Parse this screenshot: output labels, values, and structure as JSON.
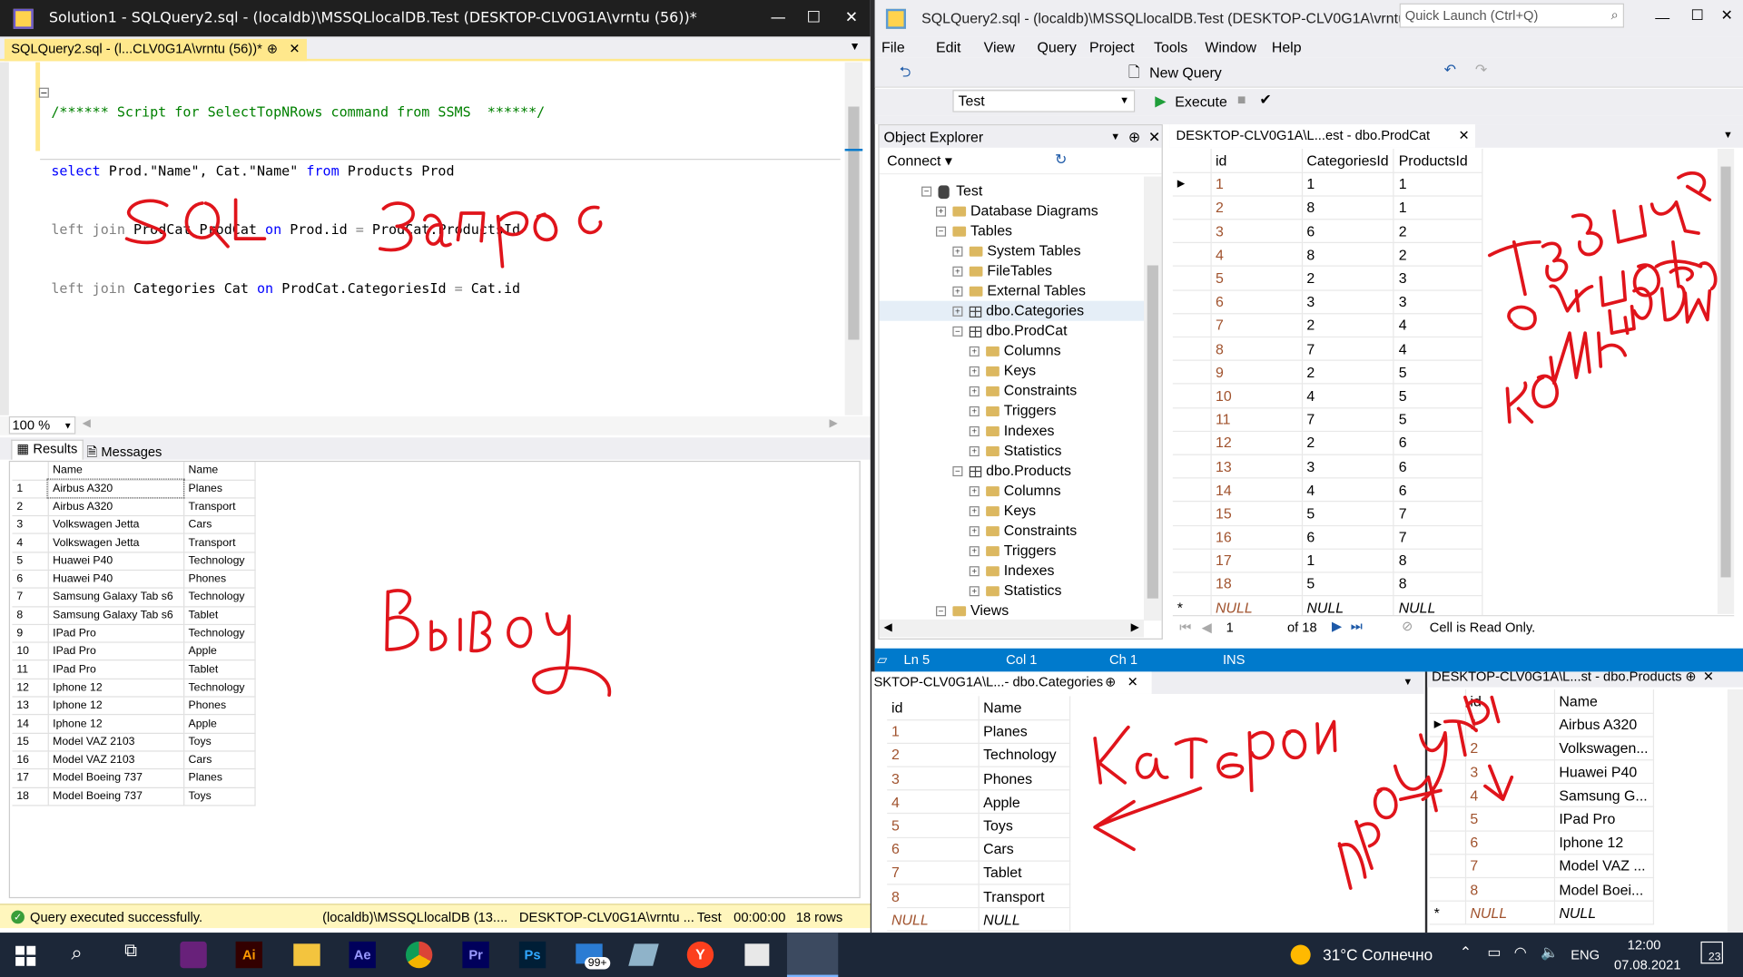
{
  "left_window": {
    "title": "Solution1 - SQLQuery2.sql - (localdb)\\MSSQLlocalDB.Test (DESKTOP-CLV0G1A\\vrntu (56))*",
    "tab": "SQLQuery2.sql - (l...CLV0G1A\\vrntu (56))*",
    "zoom": "100 %",
    "results_tab": "Results",
    "messages_tab": "Messages"
  },
  "sql": {
    "comment": "/****** Script for SelectTopNRows command from SSMS  ******/",
    "line2a": "select",
    "line2b": " Prod.\"Name\", Cat.\"Name\" ",
    "line2c": "from",
    "line2d": " Products Prod",
    "line3a": "left join",
    "line3b": " ProdCat ProdCat ",
    "line3c": "on",
    "line3d": " Prod.id ",
    "line3e": "=",
    "line3f": " ProdCat.ProductsId",
    "line4a": "left join",
    "line4b": " Categories Cat ",
    "line4c": "on",
    "line4d": " ProdCat.CategoriesId ",
    "line4e": "=",
    "line4f": " Cat.id"
  },
  "results": {
    "col1": "Name",
    "col2": "Name",
    "rows": [
      [
        "1",
        "Airbus A320",
        "Planes"
      ],
      [
        "2",
        "Airbus A320",
        "Transport"
      ],
      [
        "3",
        "Volkswagen Jetta",
        "Cars"
      ],
      [
        "4",
        "Volkswagen Jetta",
        "Transport"
      ],
      [
        "5",
        "Huawei P40",
        "Technology"
      ],
      [
        "6",
        "Huawei P40",
        "Phones"
      ],
      [
        "7",
        "Samsung Galaxy Tab s6",
        "Technology"
      ],
      [
        "8",
        "Samsung Galaxy Tab s6",
        "Tablet"
      ],
      [
        "9",
        "IPad Pro",
        "Technology"
      ],
      [
        "10",
        "IPad Pro",
        "Apple"
      ],
      [
        "11",
        "IPad Pro",
        "Tablet"
      ],
      [
        "12",
        "Iphone 12",
        "Technology"
      ],
      [
        "13",
        "Iphone 12",
        "Phones"
      ],
      [
        "14",
        "Iphone 12",
        "Apple"
      ],
      [
        "15",
        "Model VAZ 2103",
        "Toys"
      ],
      [
        "16",
        "Model VAZ 2103",
        "Cars"
      ],
      [
        "17",
        "Model Boeing 737",
        "Planes"
      ],
      [
        "18",
        "Model Boeing 737",
        "Toys"
      ]
    ]
  },
  "status_left": {
    "msg": "Query executed successfully.",
    "server": "(localdb)\\MSSQLlocalDB (13....",
    "user": "DESKTOP-CLV0G1A\\vrntu ...",
    "db": "Test",
    "time": "00:00:00",
    "rows": "18 rows"
  },
  "right_window": {
    "title": "SQLQuery2.sql - (localdb)\\MSSQLlocalDB.Test (DESKTOP-CLV0G1A\\vrntu (56))...",
    "quick_launch": "Quick Launch (Ctrl+Q)",
    "menu": [
      "File",
      "Edit",
      "View",
      "Query",
      "Project",
      "Tools",
      "Window",
      "Help"
    ],
    "new_query": "New Query",
    "db_select": "Test",
    "execute": "Execute"
  },
  "object_explorer": {
    "title": "Object Explorer",
    "connect": "Connect",
    "tree": [
      "Test",
      "Database Diagrams",
      "Tables",
      "System Tables",
      "FileTables",
      "External Tables",
      "dbo.Categories",
      "dbo.ProdCat",
      "Columns",
      "Keys",
      "Constraints",
      "Triggers",
      "Indexes",
      "Statistics",
      "dbo.Products",
      "Columns",
      "Keys",
      "Constraints",
      "Triggers",
      "Indexes",
      "Statistics",
      "Views"
    ]
  },
  "prodcat": {
    "tab": "DESKTOP-CLV0G1A\\L...est - dbo.ProdCat",
    "cols": [
      "id",
      "CategoriesId",
      "ProductsId"
    ],
    "rows": [
      [
        "1",
        "1",
        "1"
      ],
      [
        "2",
        "8",
        "1"
      ],
      [
        "3",
        "6",
        "2"
      ],
      [
        "4",
        "8",
        "2"
      ],
      [
        "5",
        "2",
        "3"
      ],
      [
        "6",
        "3",
        "3"
      ],
      [
        "7",
        "2",
        "4"
      ],
      [
        "8",
        "7",
        "4"
      ],
      [
        "9",
        "2",
        "5"
      ],
      [
        "10",
        "4",
        "5"
      ],
      [
        "11",
        "7",
        "5"
      ],
      [
        "12",
        "2",
        "6"
      ],
      [
        "13",
        "3",
        "6"
      ],
      [
        "14",
        "4",
        "6"
      ],
      [
        "15",
        "5",
        "7"
      ],
      [
        "16",
        "6",
        "7"
      ],
      [
        "17",
        "1",
        "8"
      ],
      [
        "18",
        "5",
        "8"
      ]
    ],
    "null": "NULL",
    "page": "1",
    "of": "of 18",
    "readonly": "Cell is Read Only."
  },
  "status_right": {
    "ln": "Ln 5",
    "col": "Col 1",
    "ch": "Ch 1",
    "ins": "INS"
  },
  "categories": {
    "tab": "SKTOP-CLV0G1A\\L...- dbo.Categories",
    "cols": [
      "id",
      "Name"
    ],
    "rows": [
      [
        "1",
        "Planes"
      ],
      [
        "2",
        "Technology"
      ],
      [
        "3",
        "Phones"
      ],
      [
        "4",
        "Apple"
      ],
      [
        "5",
        "Toys"
      ],
      [
        "6",
        "Cars"
      ],
      [
        "7",
        "Tablet"
      ],
      [
        "8",
        "Transport"
      ]
    ],
    "null": "NULL"
  },
  "products": {
    "tab": "DESKTOP-CLV0G1A\\L...st - dbo.Products",
    "cols": [
      "id",
      "Name"
    ],
    "rows": [
      [
        "1",
        "Airbus A320"
      ],
      [
        "2",
        "Volkswagen..."
      ],
      [
        "3",
        "Huawei P40"
      ],
      [
        "4",
        "Samsung G..."
      ],
      [
        "5",
        "IPad Pro"
      ],
      [
        "6",
        "Iphone 12"
      ],
      [
        "7",
        "Model VAZ ..."
      ],
      [
        "8",
        "Model Boei..."
      ]
    ],
    "null": "NULL"
  },
  "taskbar": {
    "weather": "31°C  Солнечно",
    "lang": "ENG",
    "time": "12:00",
    "date": "07.08.2021",
    "notif": "23",
    "badge": "99+"
  },
  "handwriting": [
    "SQL запрос",
    "Вывод",
    "Таблица связи многие ко многим",
    "Категории",
    "продукты"
  ],
  "colors": {
    "accent": "#007acc",
    "status_green": "#68217a",
    "title_bg": "#1f1f1f"
  }
}
